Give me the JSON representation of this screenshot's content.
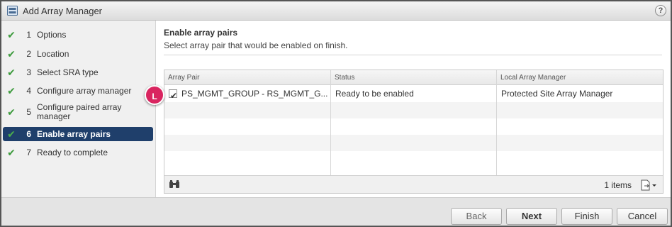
{
  "window": {
    "title": "Add Array Manager",
    "help_glyph": "?"
  },
  "steps": [
    {
      "num": "1",
      "label": "Options"
    },
    {
      "num": "2",
      "label": "Location"
    },
    {
      "num": "3",
      "label": "Select SRA type"
    },
    {
      "num": "4",
      "label": "Configure array manager"
    },
    {
      "num": "5",
      "label": "Configure paired array manager"
    },
    {
      "num": "6",
      "label": "Enable array pairs"
    },
    {
      "num": "7",
      "label": "Ready to complete"
    }
  ],
  "page": {
    "heading": "Enable array pairs",
    "description": "Select array pair that would be enabled on finish."
  },
  "grid": {
    "columns": [
      "Array Pair",
      "Status",
      "Local Array Manager"
    ],
    "rows": [
      {
        "array_pair": "PS_MGMT_GROUP - RS_MGMT_G...",
        "status": "Ready to be enabled",
        "local_array_manager": "Protected Site Array Manager",
        "checked": true
      }
    ],
    "item_count": "1 items"
  },
  "annotation": {
    "label": "L"
  },
  "buttons": {
    "back": "Back",
    "next": "Next",
    "finish": "Finish",
    "cancel": "Cancel"
  },
  "colors": {
    "active_step_bg": "#1f3f6b",
    "check_green": "#3c9a3c",
    "badge": "#d92560"
  }
}
